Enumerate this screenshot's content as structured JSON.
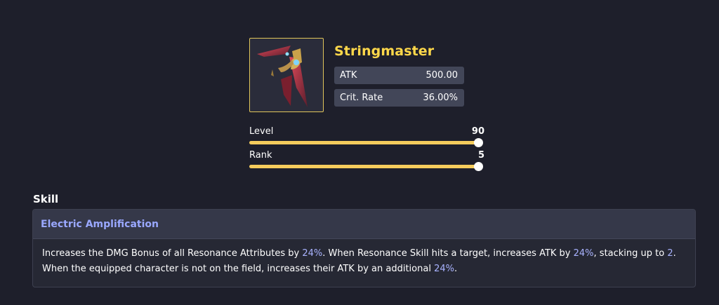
{
  "weapon": {
    "name": "Stringmaster",
    "image_icon": "broadblade-weapon-icon",
    "stats": [
      {
        "label": "ATK",
        "value": "500.00"
      },
      {
        "label": "Crit. Rate",
        "value": "36.00%"
      }
    ]
  },
  "sliders": {
    "level": {
      "label": "Level",
      "value": "90",
      "fraction": 1.0
    },
    "rank": {
      "label": "Rank",
      "value": "5",
      "fraction": 1.0
    }
  },
  "skill": {
    "section_title": "Skill",
    "name": "Electric Amplification",
    "desc": {
      "p1": "Increases the DMG Bonus of all Resonance Attributes by ",
      "v1": "24%",
      "p2": ". When Resonance Skill hits a target, increases ATK by ",
      "v2": "24%",
      "p3": ", stacking up to ",
      "v3": "2",
      "p4": ".",
      "p5": "When the equipped character is not on the field, increases their ATK by an additional ",
      "v4": "24%",
      "p6": "."
    }
  },
  "colors": {
    "background": "#1e1f2b",
    "accent_gold": "#ffd84a",
    "slider_fill": "#f5cc5c",
    "highlight": "#a9b3ff"
  }
}
